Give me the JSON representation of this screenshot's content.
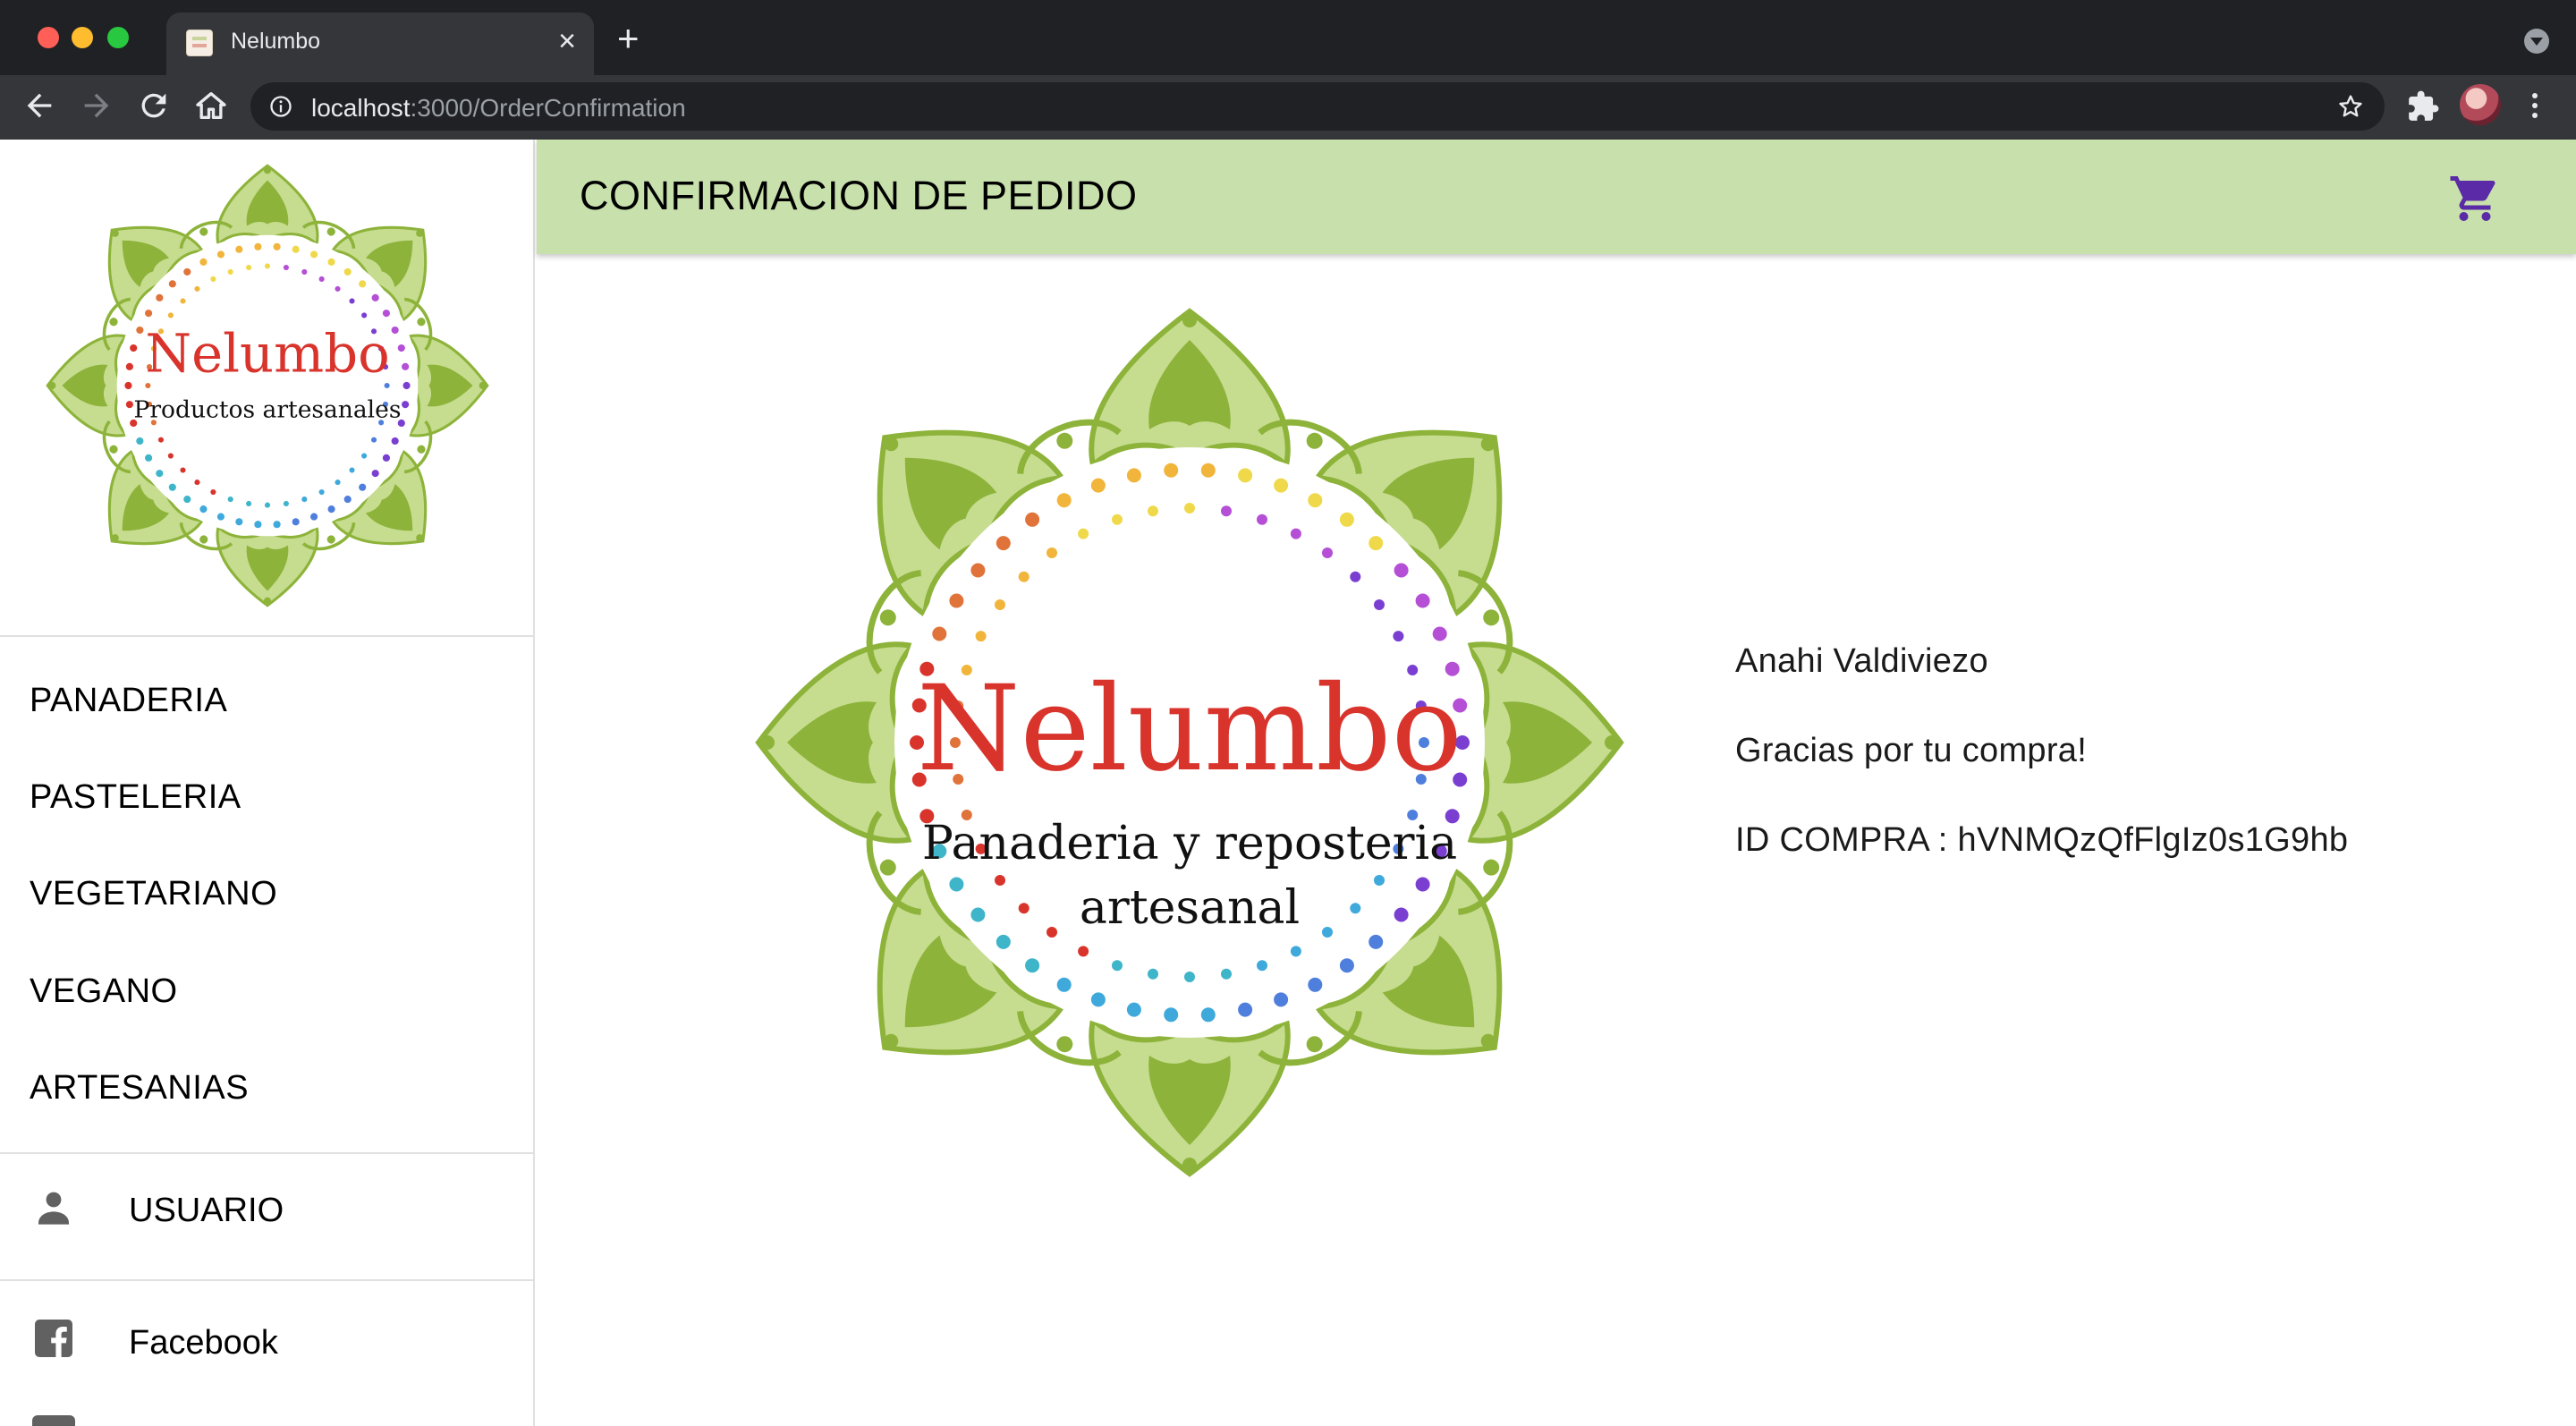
{
  "browser": {
    "tab_title": "Nelumbo",
    "url_host": "localhost",
    "url_rest": ":3000/OrderConfirmation"
  },
  "sidebar": {
    "logo": {
      "title": "Nelumbo",
      "subtitle": "Productos artesanales"
    },
    "categories": [
      {
        "label": "PANADERIA"
      },
      {
        "label": "PASTELERIA"
      },
      {
        "label": "VEGETARIANO"
      },
      {
        "label": "VEGANO"
      },
      {
        "label": "ARTESANIAS"
      }
    ],
    "user_label": "USUARIO",
    "facebook_label": "Facebook"
  },
  "header": {
    "title": "CONFIRMACION DE PEDIDO"
  },
  "main": {
    "logo": {
      "title": "Nelumbo",
      "line1": "Panaderia y reposteria",
      "line2": "artesanal"
    },
    "customer_name": "Anahi Valdiviezo",
    "thanks": "Gracias por tu compra!",
    "purchase_id": "ID COMPRA : hVNMQzQfFlgIz0s1G9hb"
  },
  "colors": {
    "appbar": "#c8e1ac",
    "cart_icon": "#5b2aa6",
    "logo_green": "#8db33a",
    "logo_red": "#d8342c"
  }
}
